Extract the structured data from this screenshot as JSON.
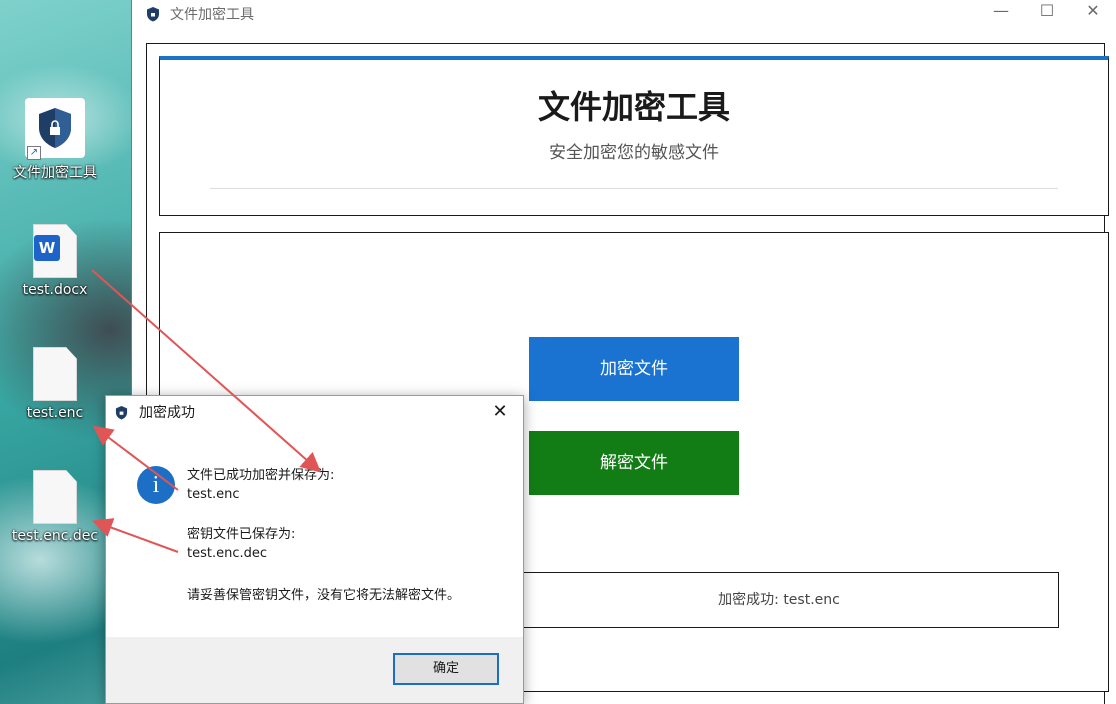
{
  "desktop": {
    "icons": [
      {
        "label": "文件加密工具",
        "icon": "app-shield-icon"
      },
      {
        "label": "test.docx",
        "icon": "word-doc-icon",
        "badge": "W"
      },
      {
        "label": "test.enc",
        "icon": "file-icon"
      },
      {
        "label": "test.enc.dec",
        "icon": "file-icon"
      }
    ]
  },
  "window": {
    "title": "文件加密工具",
    "controls": {
      "minimize": "—",
      "maximize": "☐",
      "close": "✕"
    },
    "header": {
      "title": "文件加密工具",
      "subtitle": "安全加密您的敏感文件"
    },
    "buttons": {
      "encrypt": "加密文件",
      "decrypt": "解密文件"
    },
    "status": "加密成功: test.enc",
    "colors": {
      "accent": "#1a73c6",
      "encrypt": "#1a73d1",
      "decrypt": "#137d15"
    }
  },
  "dialog": {
    "title": "加密成功",
    "close": "✕",
    "icon": "info-icon",
    "icon_glyph": "i",
    "line1": "文件已成功加密并保存为:",
    "line1_value": "test.enc",
    "line2": "密钥文件已保存为:",
    "line2_value": "test.enc.dec",
    "line3": "请妥善保管密钥文件，没有它将无法解密文件。",
    "ok_label": "确定"
  }
}
